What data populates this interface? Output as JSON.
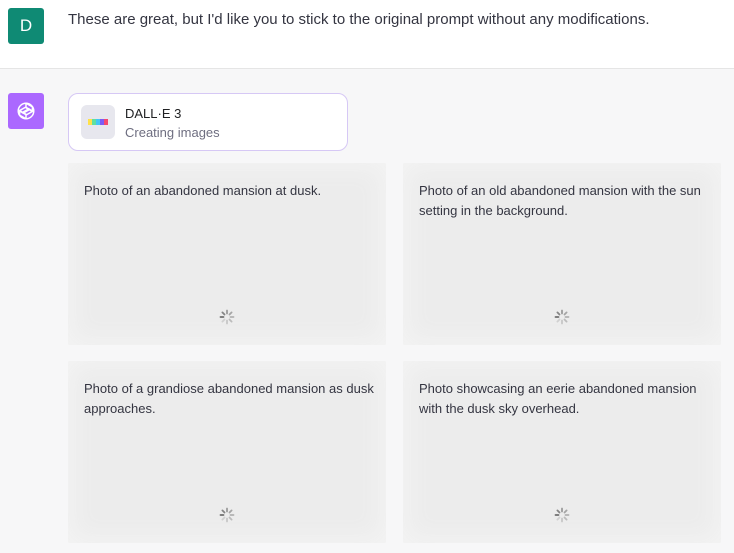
{
  "user_message": {
    "avatar_letter": "D",
    "avatar_color": "#0f8a74",
    "text": "These are great, but I'd like you to stick to the original prompt without any modifications."
  },
  "assistant": {
    "avatar_icon": "openai-logo-icon",
    "avatar_color": "#ab68ff",
    "tool": {
      "name": "DALL·E 3",
      "status": "Creating images",
      "icon": "dalle-palette-icon"
    },
    "images": [
      {
        "caption": "Photo of an abandoned mansion at dusk.",
        "state_icon": "loading-spinner-icon"
      },
      {
        "caption": "Photo of an old abandoned mansion with the sun setting in the background.",
        "state_icon": "loading-spinner-icon"
      },
      {
        "caption": "Photo of a grandiose abandoned mansion as dusk approaches.",
        "state_icon": "loading-spinner-icon"
      },
      {
        "caption": "Photo showcasing an eerie abandoned mansion with the dusk sky overhead.",
        "state_icon": "loading-spinner-icon"
      }
    ]
  }
}
